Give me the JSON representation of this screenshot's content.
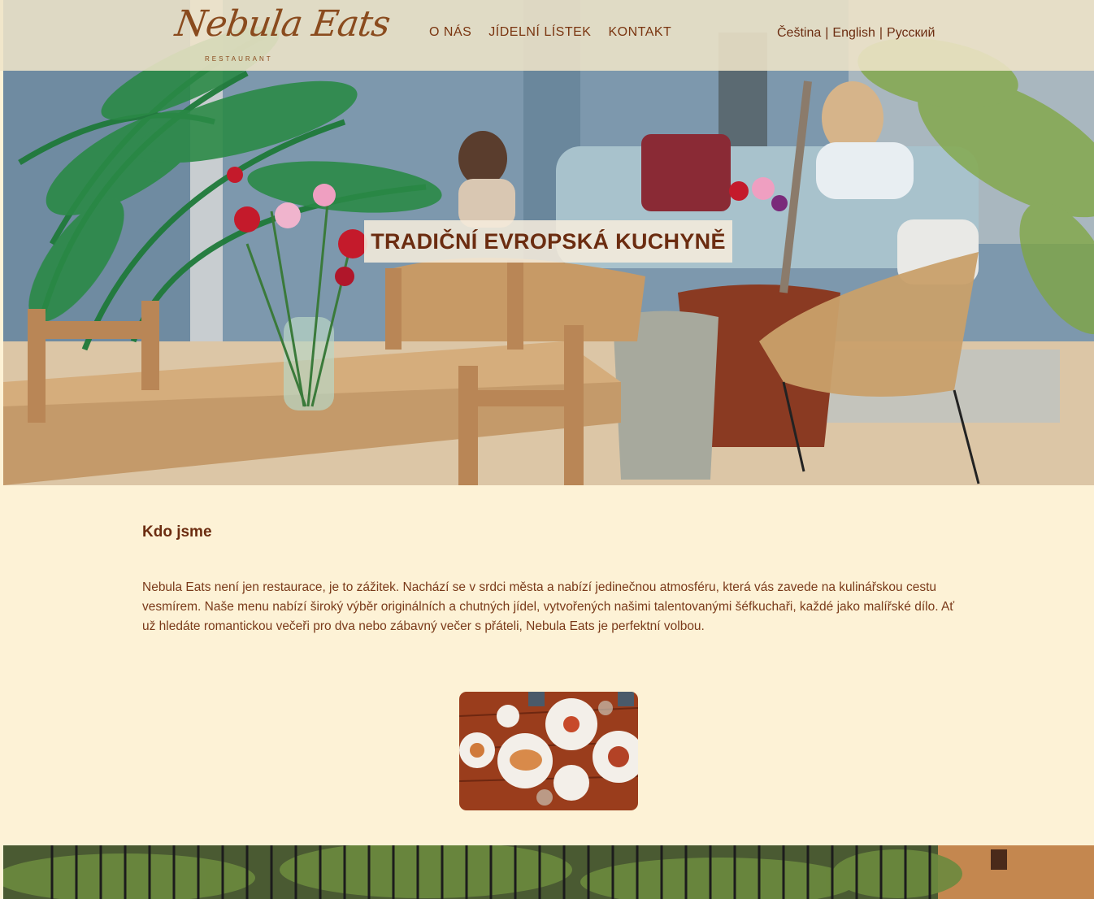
{
  "brand": {
    "logo_script": "Nebula Eats",
    "logo_sub": "RESTAURANT"
  },
  "nav": {
    "items": [
      {
        "label": "O NÁS"
      },
      {
        "label": "JÍDELNÍ LÍSTEK"
      },
      {
        "label": "KONTAKT"
      }
    ]
  },
  "languages": {
    "items": [
      "Čeština",
      "English",
      "Русский"
    ],
    "separator": "|"
  },
  "hero": {
    "title": "TRADIČNÍ EVROPSKÁ KUCHYNĚ"
  },
  "about": {
    "heading": "Kdo jsme",
    "text": "Nebula Eats není jen restaurace, je to zážitek. Nachází se v srdci města a nabízí jedinečnou atmosféru, která vás zavede na kulinářskou cestu vesmírem. Naše menu nabízí široký výběr originálních a chutných jídel, vytvořených našimi talentovanými šéfkuchaři, každé jako malířské dílo. Ať už hledáte romantickou večeři pro dva nebo zábavný večer s přáteli, Nebula Eats je perfektní volbou."
  },
  "colors": {
    "page_bg": "#fdf2d6",
    "brand_brown": "#6b2c10",
    "header_bg": "#eee4c8"
  }
}
